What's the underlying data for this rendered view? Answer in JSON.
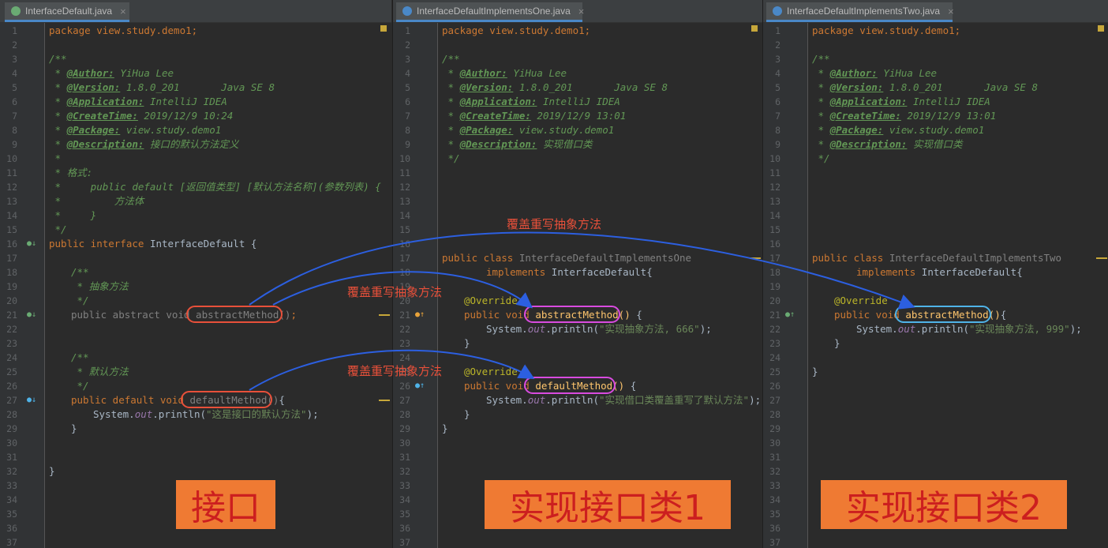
{
  "panes": [
    {
      "tab_title": "InterfaceDefault.java",
      "icon": "interface-icon",
      "lines": {
        "l1": "package view.study.demo1;",
        "l3": "/**",
        "l4_tag": "@Author:",
        "l4_val": " YiHua Lee",
        "l5_tag": "@Version:",
        "l5_val": " 1.8.0_201       Java SE 8",
        "l6_tag": "@Application:",
        "l6_val": " IntelliJ IDEA",
        "l7_tag": "@CreateTime:",
        "l7_val": " 2019/12/9 10:24",
        "l8_tag": "@Package:",
        "l8_val": " view.study.demo1",
        "l9_tag": "@Description:",
        "l9_val": " 接口的默认方法定义",
        "l10": " *",
        "l11": " * 格式:",
        "l12": " *     public default [返回值类型] [默认方法名称](参数列表) {",
        "l13": " *         方法体",
        "l14": " *     }",
        "l15": " */",
        "l16_kw": "public interface",
        "l16_rest": " InterfaceDefault {",
        "l18": "/**",
        "l19": " * 抽象方法",
        "l20": " */",
        "l21_kw": "public abstract void",
        "l21_m": "abstractMethod()",
        "l21_end": ";",
        "l24": "/**",
        "l25": " * 默认方法",
        "l26": " */",
        "l27_kw": "public default void",
        "l27_m": "defaultMethod()",
        "l27_end": "{",
        "l28_a": "System.",
        "l28_f": "out",
        "l28_b": ".println(",
        "l28_s": "\"这是接口的默认方法\"",
        "l28_c": ");",
        "l29": "}",
        "l32": "}"
      }
    },
    {
      "tab_title": "InterfaceDefaultImplementsOne.java",
      "icon": "class-icon",
      "lines": {
        "l1": "package view.study.demo1;",
        "l3": "/**",
        "l4_tag": "@Author:",
        "l4_val": " YiHua Lee",
        "l5_tag": "@Version:",
        "l5_val": " 1.8.0_201       Java SE 8",
        "l6_tag": "@Application:",
        "l6_val": " IntelliJ IDEA",
        "l7_tag": "@CreateTime:",
        "l7_val": " 2019/12/9 13:01",
        "l8_tag": "@Package:",
        "l8_val": " view.study.demo1",
        "l9_tag": "@Description:",
        "l9_val": " 实现借口类",
        "l10": " */",
        "l17_kw": "public class",
        "l17_rest": " InterfaceDefaultImplementsOne",
        "l18_kw": "implements",
        "l18_rest": " InterfaceDefault{",
        "l20": "@Override",
        "l21_kw": "public void",
        "l21_m": "abstractMethod()",
        "l21_end": " {",
        "l22_a": "System.",
        "l22_f": "out",
        "l22_b": ".println(",
        "l22_s": "\"实现抽象方法, 666\"",
        "l22_c": ");",
        "l23": "}",
        "l25": "@Override",
        "l26_kw": "public void",
        "l26_m": "defaultMethod()",
        "l26_end": " {",
        "l27_a": "System.",
        "l27_f": "out",
        "l27_b": ".println(",
        "l27_s": "\"实现借口类覆盖重写了默认方法\"",
        "l27_c": ");",
        "l28": "}",
        "l29": "}"
      }
    },
    {
      "tab_title": "InterfaceDefaultImplementsTwo.java",
      "icon": "class-icon",
      "lines": {
        "l1": "package view.study.demo1;",
        "l3": "/**",
        "l4_tag": "@Author:",
        "l4_val": " YiHua Lee",
        "l5_tag": "@Version:",
        "l5_val": " 1.8.0_201       Java SE 8",
        "l6_tag": "@Application:",
        "l6_val": " IntelliJ IDEA",
        "l7_tag": "@CreateTime:",
        "l7_val": " 2019/12/9 13:01",
        "l8_tag": "@Package:",
        "l8_val": " view.study.demo1",
        "l9_tag": "@Description:",
        "l9_val": " 实现借口类",
        "l10": " */",
        "l17_kw": "public class",
        "l17_rest": " InterfaceDefaultImplementsTwo",
        "l18_kw": "implements",
        "l18_rest": " InterfaceDefault{",
        "l20": "@Override",
        "l21_kw": "public void",
        "l21_m": "abstractMethod()",
        "l21_end": "{",
        "l22_a": "System.",
        "l22_f": "out",
        "l22_b": ".println(",
        "l22_s": "\"实现抽象方法, 999\"",
        "l22_c": ");",
        "l23": "}",
        "l25": "}"
      }
    }
  ],
  "annotations": {
    "override_note_1": "覆盖重写抽象方法",
    "override_note_2": "覆盖重写抽象方法",
    "override_note_3": "覆盖重写抽象方法",
    "label_interface": "接口",
    "label_impl_one": "实现接口类1",
    "label_impl_two": "实现接口类2",
    "arrow_color": "#2c5fe0",
    "oval_red": "#e8503a",
    "oval_magenta": "#d94be0",
    "oval_cyan": "#4fb3e8"
  },
  "colors": {
    "editor_bg": "#2b2b2b",
    "keyword": "#cc7832",
    "javadoc": "#629755",
    "annotation": "#bbb529",
    "method": "#ffc66d",
    "label_bg": "#ef7a33"
  }
}
